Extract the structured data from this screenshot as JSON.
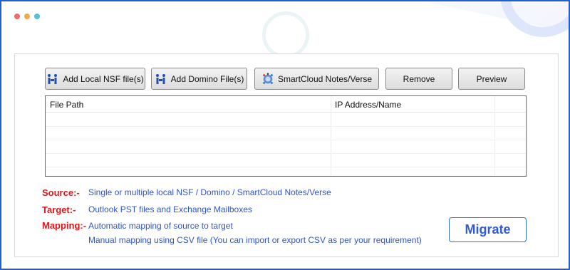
{
  "window": {
    "dot_colors": [
      "#ee6b6b",
      "#f2a64a",
      "#53c0d6"
    ]
  },
  "toolbar": {
    "buttons": [
      {
        "label": "Add Local NSF file(s)",
        "icon": "lotus-notes-icon"
      },
      {
        "label": "Add Domino File(s)",
        "icon": "lotus-notes-icon"
      },
      {
        "label": "SmartCloud Notes/Verse",
        "icon": "smartcloud-globe-icon"
      },
      {
        "label": "Remove",
        "icon": ""
      },
      {
        "label": "Preview",
        "icon": ""
      }
    ]
  },
  "file_table": {
    "columns": [
      "File Path",
      "IP Address/Name"
    ],
    "rows": []
  },
  "info": {
    "source_label": "Source:-",
    "source_text": "Single or multiple local NSF / Domino / SmartCloud Notes/Verse",
    "target_label": "Target:-",
    "target_text": "Outlook PST files and Exchange Mailboxes",
    "mapping_label": "Mapping:-",
    "mapping_line1": "Automatic mapping of source to target",
    "mapping_line2": "Manual mapping using CSV file (You can import or export CSV as per your requirement)"
  },
  "actions": {
    "migrate_label": "Migrate"
  },
  "colors": {
    "accent": "#1f5fd6",
    "label_red": "#e0141b",
    "text_blue": "#2f54c8"
  }
}
